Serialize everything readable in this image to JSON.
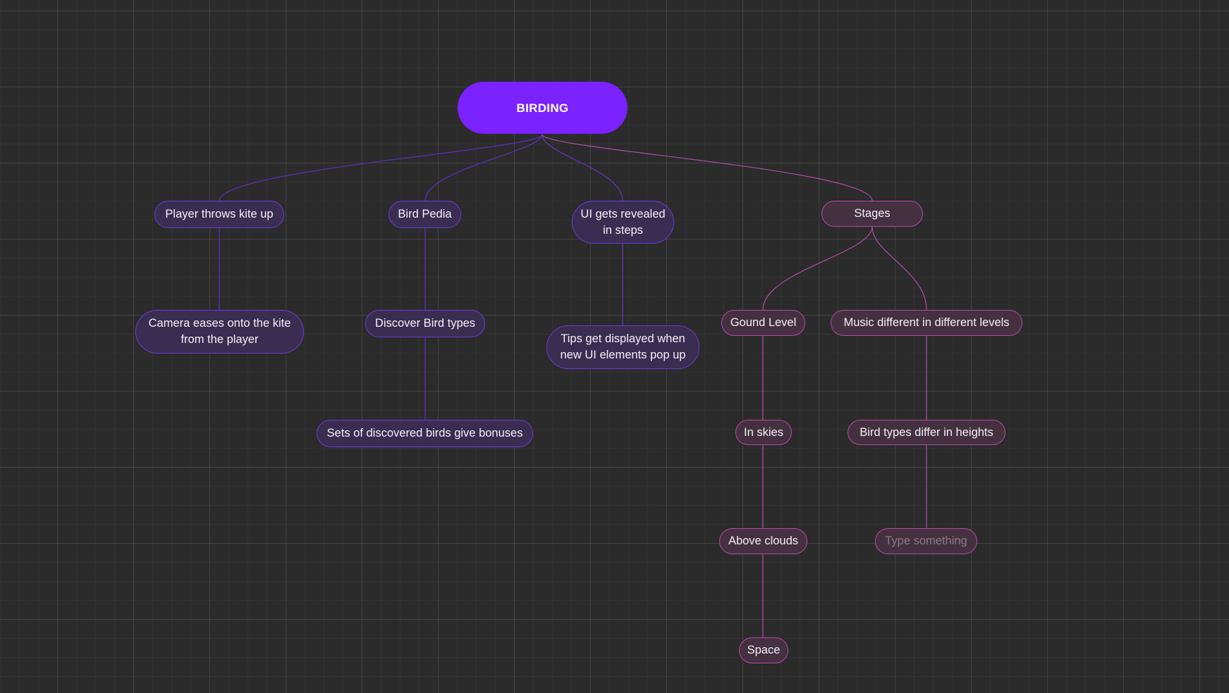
{
  "mindmap": {
    "root": {
      "label": "BIRDING",
      "color": "#7b22ff"
    },
    "colors": {
      "purple_branch": "#6a3cd8",
      "pink_branch": "#b34aa6",
      "background": "#2b2b2b"
    },
    "nodes": {
      "player_throws": "Player throws kite up",
      "camera_eases": "Camera eases onto the kite\nfrom the player",
      "bird_pedia": "Bird Pedia",
      "discover_bird_types": "Discover Bird types",
      "sets_discovered": "Sets of discovered birds give bonuses",
      "ui_revealed": "UI gets revealed\nin steps",
      "tips_displayed": "Tips get displayed when\nnew UI elements pop up",
      "stages": "Stages",
      "ground_level": "Gound Level",
      "in_skies": "In skies",
      "above_clouds": "Above clouds",
      "space": "Space",
      "music_different": "Music different in different levels",
      "bird_types_heights": "Bird types differ in heights",
      "type_something": "Type something"
    }
  }
}
